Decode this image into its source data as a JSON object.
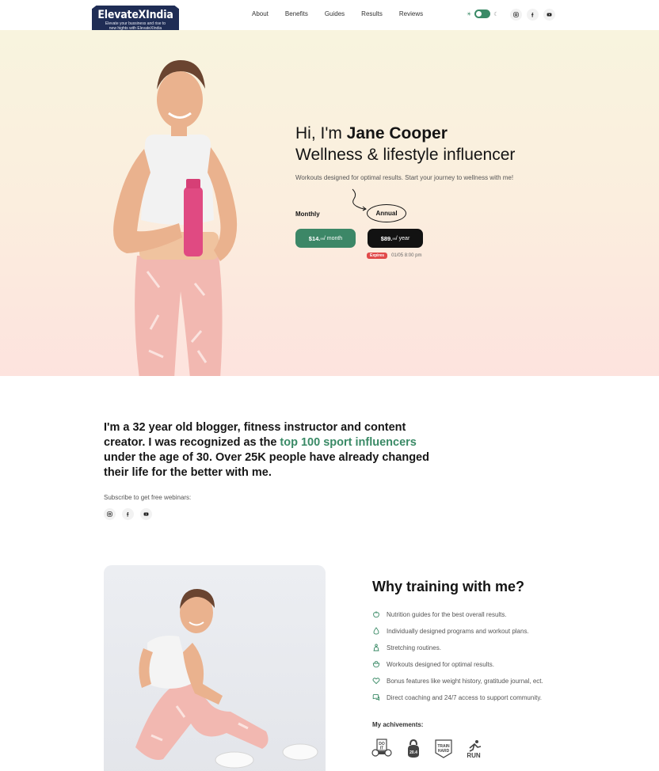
{
  "header": {
    "logo_name": "ElevateXIndia",
    "logo_tagline": "Elevate your bussiness and rise to new hights with ElevateXIndia",
    "nav": [
      "About",
      "Benefits",
      "Guides",
      "Results",
      "Reviews"
    ]
  },
  "hero": {
    "greeting": "Hi, I'm ",
    "name": "Jane Cooper",
    "role": "Wellness & lifestyle influencer",
    "subtitle": "Workouts designed for optimal results. Start your journey to wellness with me!",
    "monthly_label": "Monthly",
    "annual_label": "Annual",
    "monthly_price": "$14.",
    "monthly_cents": "99",
    "monthly_period": " / month",
    "annual_price": "$89.",
    "annual_cents": "99",
    "annual_period": " / year",
    "expires_badge": "Expires",
    "expires_date": "01/05 8:00 pm"
  },
  "about": {
    "text_before": "I'm a 32 year old blogger, fitness instructor and content creator. I was recognized as the ",
    "highlight": "top 100 sport influencers",
    "text_after": " under the age of 30. Over 25K people have already changed their life for the better with me.",
    "subscribe": "Subscribe to get free webinars:"
  },
  "training": {
    "title": "Why training with me?",
    "features": [
      "Nutrition guides for the best overall results.",
      "Individually designed programs and workout plans.",
      "Stretching routines.",
      "Workouts designed for optimal results.",
      "Bonus features like weight history, gratitude journal, ect.",
      "Direct coaching and 24/7 access to support community."
    ],
    "achievements_title": "My achivements:",
    "badges": [
      "DO IT",
      "20.4",
      "TRAIN HARD",
      "RUN"
    ]
  },
  "colors": {
    "accent": "#3a8a66",
    "dark": "#121212",
    "badge_red": "#e14a4a",
    "logo_bg": "#1f2d55"
  },
  "icons": [
    "sun-icon",
    "moon-icon",
    "instagram-icon",
    "facebook-icon",
    "youtube-icon",
    "apple-icon",
    "drop-icon",
    "stretch-icon",
    "bowl-icon",
    "heart-icon",
    "chat-icon"
  ]
}
